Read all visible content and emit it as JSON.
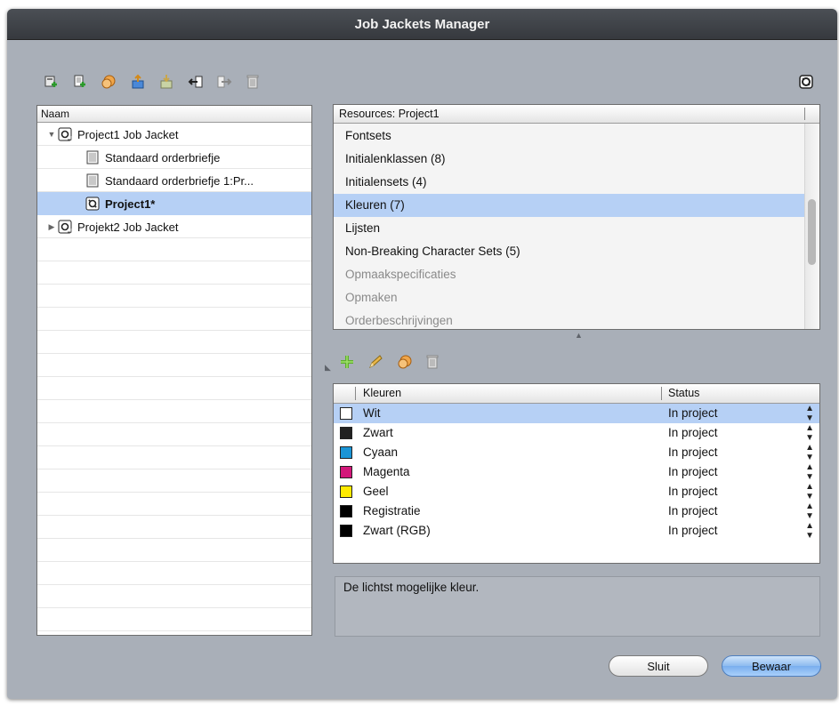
{
  "window": {
    "title": "Job Jackets Manager"
  },
  "toolbar": {
    "icons": [
      "new-job-jacket-icon",
      "new-ticket-icon",
      "duplicate-icon",
      "export-icon",
      "import-icon",
      "link-in-icon",
      "link-out-icon",
      "trash-icon"
    ],
    "right_icon": "job-jacket-icon"
  },
  "tree": {
    "header": "Naam",
    "rows": [
      {
        "label": "Project1 Job Jacket",
        "expanded": true,
        "icon": "job-jacket-icon"
      },
      {
        "label": "Standaard orderbriefje",
        "icon": "document-icon"
      },
      {
        "label": "Standaard orderbriefje 1:Pr...",
        "icon": "document-icon"
      },
      {
        "label": "Project1*",
        "icon": "project-icon",
        "selected": true
      },
      {
        "label": "Projekt2 Job Jacket",
        "expanded": false,
        "icon": "job-jacket-icon"
      }
    ]
  },
  "resources": {
    "header": "Resources: Project1",
    "items": [
      {
        "label": "Fontsets"
      },
      {
        "label": "Initialenklassen (8)"
      },
      {
        "label": "Initialensets (4)"
      },
      {
        "label": "Kleuren (7)",
        "selected": true
      },
      {
        "label": "Lijsten"
      },
      {
        "label": "Non-Breaking Character Sets (5)"
      },
      {
        "label": "Opmaakspecificaties",
        "dimmed": true
      },
      {
        "label": "Opmaken",
        "dimmed": true
      },
      {
        "label": "Orderbeschrijvingen",
        "dimmed": true
      }
    ]
  },
  "edit_toolbar": {
    "icons": [
      "add-icon",
      "edit-pencil-icon",
      "duplicate-icon",
      "trash-icon"
    ]
  },
  "colors": {
    "headers": {
      "name": "Kleuren",
      "status": "Status"
    },
    "rows": [
      {
        "name": "Wit",
        "status": "In project",
        "swatch": "#ffffff",
        "selected": true
      },
      {
        "name": "Zwart",
        "status": "In project",
        "swatch": "#222222"
      },
      {
        "name": "Cyaan",
        "status": "In project",
        "swatch": "#1b95d6"
      },
      {
        "name": "Magenta",
        "status": "In project",
        "swatch": "#d3187a"
      },
      {
        "name": "Geel",
        "status": "In project",
        "swatch": "#ffea00"
      },
      {
        "name": "Registratie",
        "status": "In project",
        "swatch": "#000000"
      },
      {
        "name": "Zwart (RGB)",
        "status": "In project",
        "swatch": "#000000"
      }
    ]
  },
  "description": "De lichtst mogelijke kleur.",
  "buttons": {
    "close": "Sluit",
    "save": "Bewaar"
  }
}
